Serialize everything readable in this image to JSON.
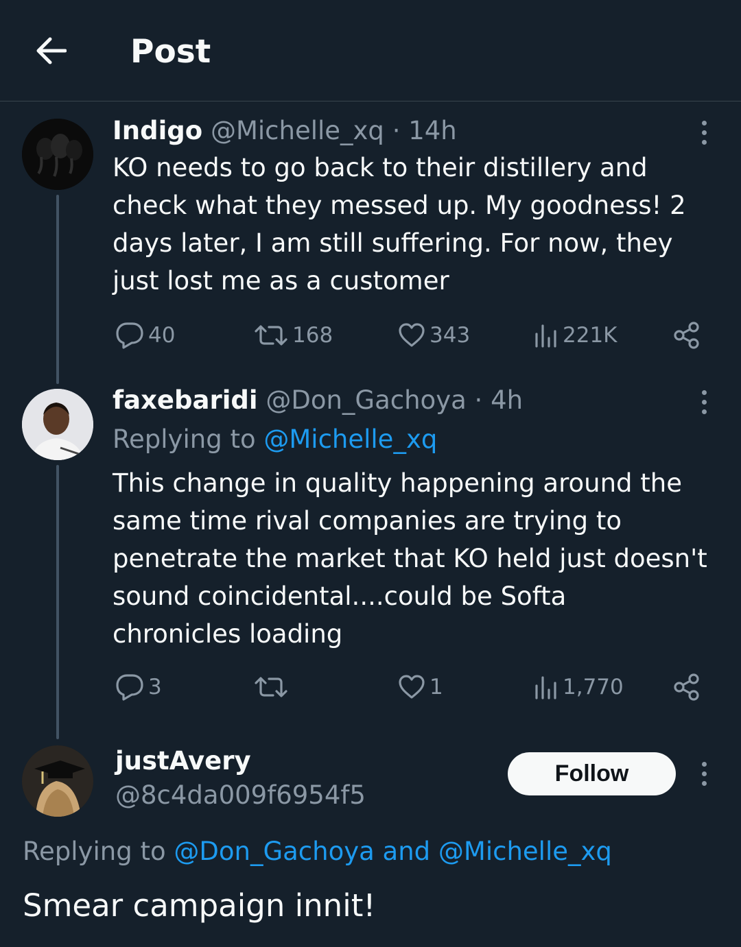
{
  "header": {
    "title": "Post",
    "back_icon": "arrow-left-icon"
  },
  "tweets": [
    {
      "name": "Indigo",
      "handle": "@Michelle_xq",
      "dot": "·",
      "time": "14h",
      "text_lines": [
        "KO needs to go back to their distillery and",
        "check what they messed up. My goodness! 2",
        "days later, I am still suffering. For now, they",
        "just lost me as a customer"
      ],
      "replies": "40",
      "reposts": "168",
      "likes": "343",
      "views": "221K"
    },
    {
      "name": "faxebaridi",
      "handle": "@Don_Gachoya",
      "dot": "·",
      "time": "4h",
      "replying_prefix": "Replying to ",
      "replying_to": "@Michelle_xq",
      "text_lines": [
        "This change in quality happening around the",
        "same time rival companies are trying to",
        "penetrate the market that KO held just doesn't",
        "sound coincidental....could be Softa",
        "chronicles loading"
      ],
      "replies": "3",
      "reposts": "",
      "likes": "1",
      "views": "1,770"
    }
  ],
  "focus_tweet": {
    "name": "justAvery",
    "handle": "@8c4da009f6954f5",
    "follow_label": "Follow",
    "replying_prefix": "Replying to ",
    "replying_to": "@Don_Gachoya and @Michelle_xq",
    "text": "Smear campaign innit!"
  },
  "icons": {
    "reply": "reply-icon",
    "repost": "repost-icon",
    "like": "heart-icon",
    "views": "views-icon",
    "share": "share-icon",
    "more": "more-vertical-icon"
  },
  "colors": {
    "background": "#15202b",
    "secondary_text": "#8b98a5",
    "link": "#1d9bf0",
    "divider": "#38444d"
  }
}
